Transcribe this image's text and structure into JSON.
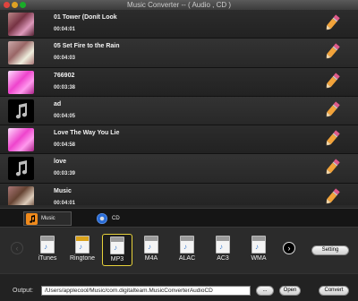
{
  "window": {
    "title": "Music Converter -- ( Audio , CD )"
  },
  "tracks": [
    {
      "title": "01 Tower (Donít Look",
      "time": "00:04:01",
      "art": "photo"
    },
    {
      "title": "05 Set Fire to the Rain",
      "time": "00:04:03",
      "art": "photo2"
    },
    {
      "title": "766902",
      "time": "00:03:38",
      "art": "photo3"
    },
    {
      "title": "ad",
      "time": "00:04:05",
      "art": "note"
    },
    {
      "title": "Love The Way You Lie",
      "time": "00:04:58",
      "art": "photo3"
    },
    {
      "title": "love",
      "time": "00:03:39",
      "art": "note"
    },
    {
      "title": "Music",
      "time": "00:04:01",
      "art": "photo4"
    }
  ],
  "tabs": {
    "music": "Music",
    "cd": "CD"
  },
  "formats": [
    {
      "label": "iTunes",
      "band": "#9a9a9a",
      "glyph": "♪",
      "selected": false
    },
    {
      "label": "Ringtone",
      "band": "#d9a21a",
      "glyph": "♪",
      "selected": false
    },
    {
      "label": "MP3",
      "band": "#9a9a9a",
      "glyph": "♪",
      "selected": true
    },
    {
      "label": "M4A",
      "band": "#9a9a9a",
      "glyph": "♪",
      "selected": false
    },
    {
      "label": "ALAC",
      "band": "#9a9a9a",
      "glyph": "♪",
      "selected": false
    },
    {
      "label": "AC3",
      "band": "#9a9a9a",
      "glyph": "♪",
      "selected": false
    },
    {
      "label": "WMA",
      "band": "#9a9a9a",
      "glyph": "♪",
      "selected": false
    }
  ],
  "setting_label": "Setting",
  "output": {
    "label": "Output:",
    "path": "/Users/applecool/Music/com.digitalteam.MusicConverterAudioCD",
    "browse_label": "...",
    "open_label": "Open",
    "convert_label": "Convert"
  },
  "colors": {
    "selected_border": "#e7d23b",
    "music_tab_accent": "#f08a1c",
    "edit_pencil": "#f2a33a"
  }
}
